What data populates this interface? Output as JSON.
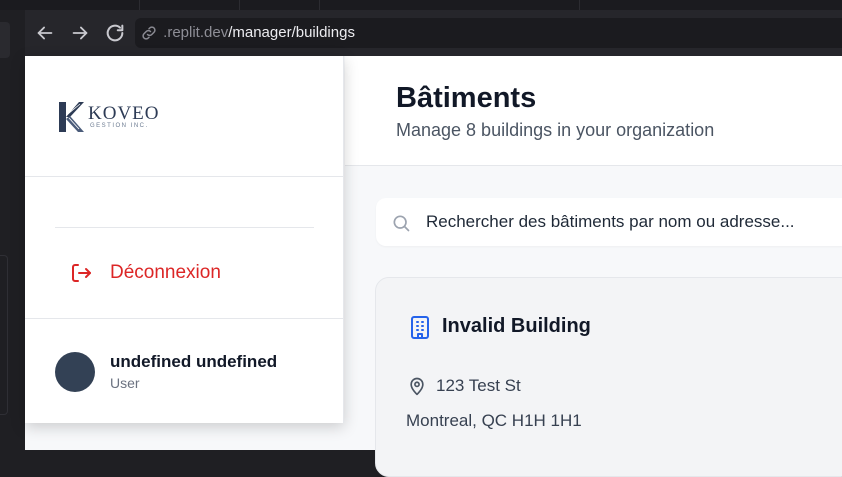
{
  "browser": {
    "url_host": " .replit.dev",
    "url_path": "/manager/buildings"
  },
  "sidebar": {
    "logo_text": "KOVEO",
    "logo_subtext": "GESTION INC.",
    "logout_label": "Déconnexion",
    "user": {
      "name": "undefined undefined",
      "role": "User"
    }
  },
  "header": {
    "title": "Bâtiments",
    "subtitle": "Manage 8 buildings in your organization"
  },
  "search": {
    "placeholder": "Rechercher des bâtiments par nom ou adresse..."
  },
  "buildings": [
    {
      "name": "Invalid Building",
      "address_line1": "123 Test St",
      "address_line2": "Montreal, QC H1H 1H1"
    }
  ],
  "icons": {
    "back": "arrow-left-icon",
    "forward": "arrow-right-icon",
    "reload": "reload-icon",
    "link": "link-icon",
    "logout": "logout-icon",
    "search": "search-icon",
    "building": "building-icon",
    "pin": "map-pin-icon"
  },
  "colors": {
    "danger": "#dc2626",
    "accent": "#2563eb",
    "avatar": "#334155"
  }
}
